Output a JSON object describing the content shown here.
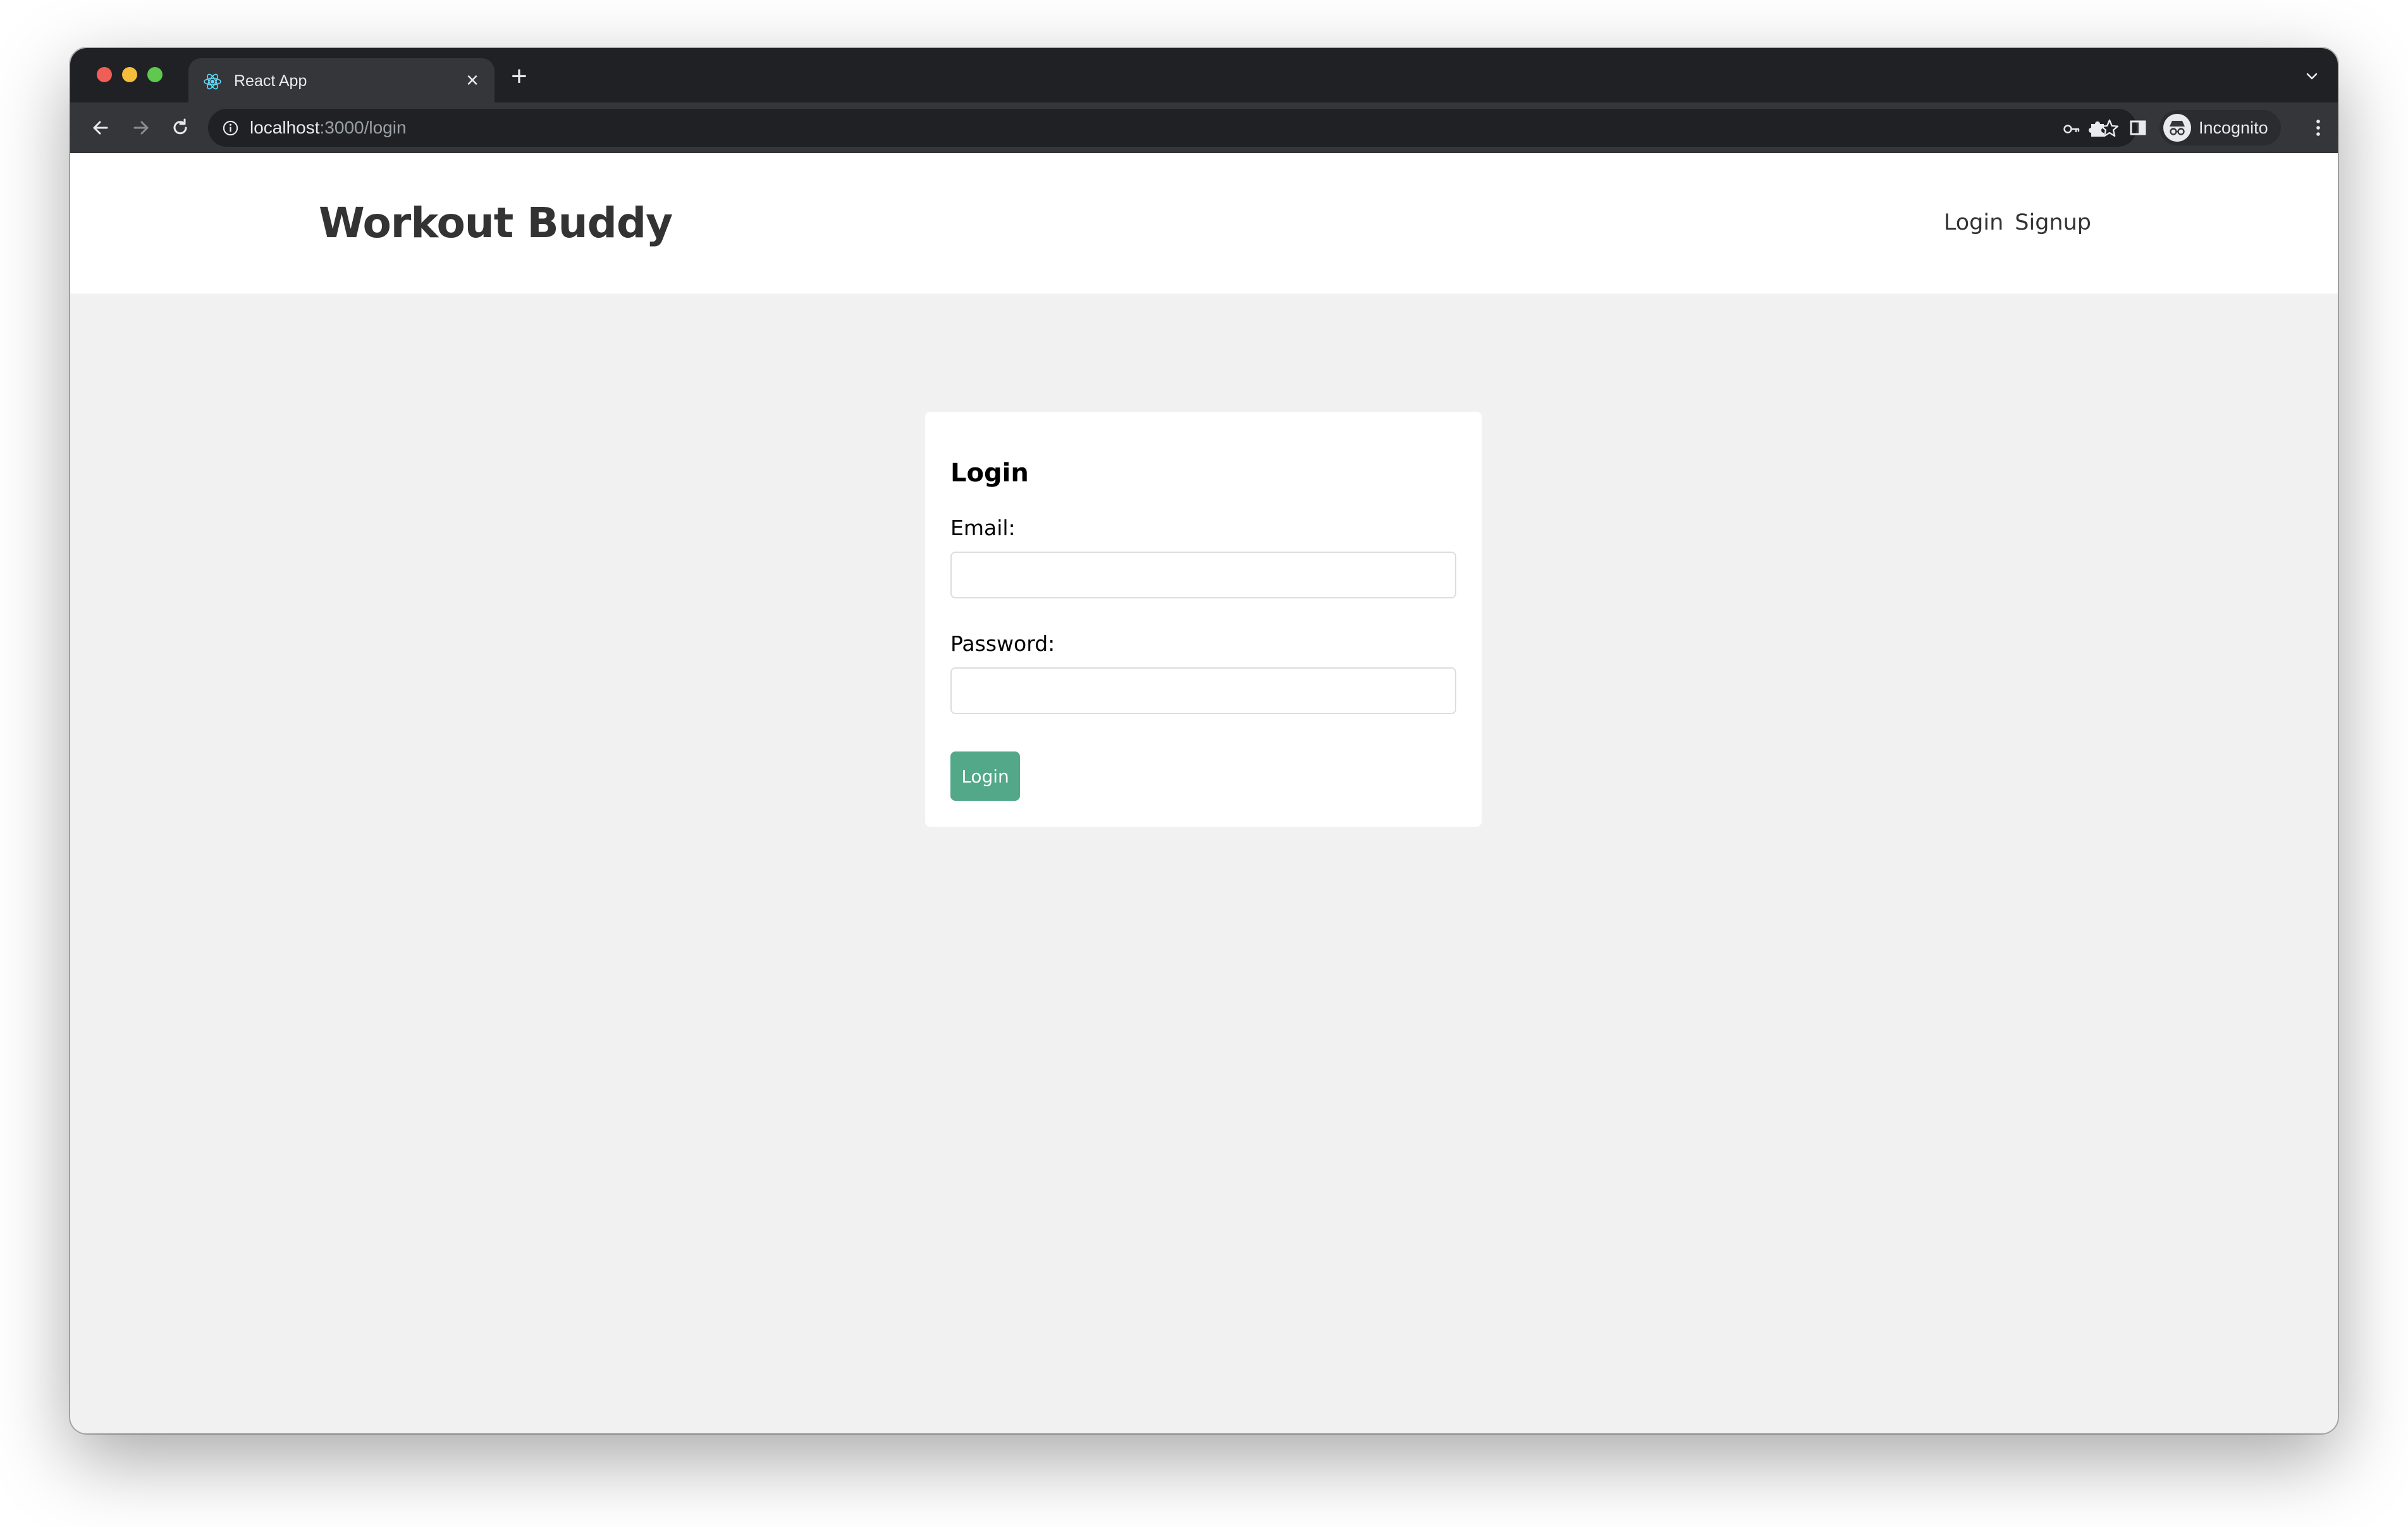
{
  "browser": {
    "tab_title": "React App",
    "tab_close_glyph": "×",
    "new_tab_glyph": "+",
    "url_host": "localhost",
    "url_path": ":3000/login",
    "profile_label": "Incognito",
    "icons": [
      "back-icon",
      "forward-icon",
      "reload-icon",
      "info-icon",
      "key-icon",
      "star-icon",
      "puzzle-icon",
      "sidepanel-icon",
      "incognito-icon",
      "kebab-menu-icon",
      "react-favicon",
      "chevron-down-icon"
    ]
  },
  "header": {
    "brand": "Workout Buddy",
    "nav": [
      {
        "label": "Login"
      },
      {
        "label": "Signup"
      }
    ]
  },
  "login_form": {
    "title": "Login",
    "email_label": "Email:",
    "email_value": "",
    "password_label": "Password:",
    "password_value": "",
    "submit_label": "Login"
  },
  "colors": {
    "accent": "#53a88a",
    "page_bg": "#f1f1f1",
    "chrome_dark": "#202124",
    "chrome_toolbar": "#35363a"
  }
}
